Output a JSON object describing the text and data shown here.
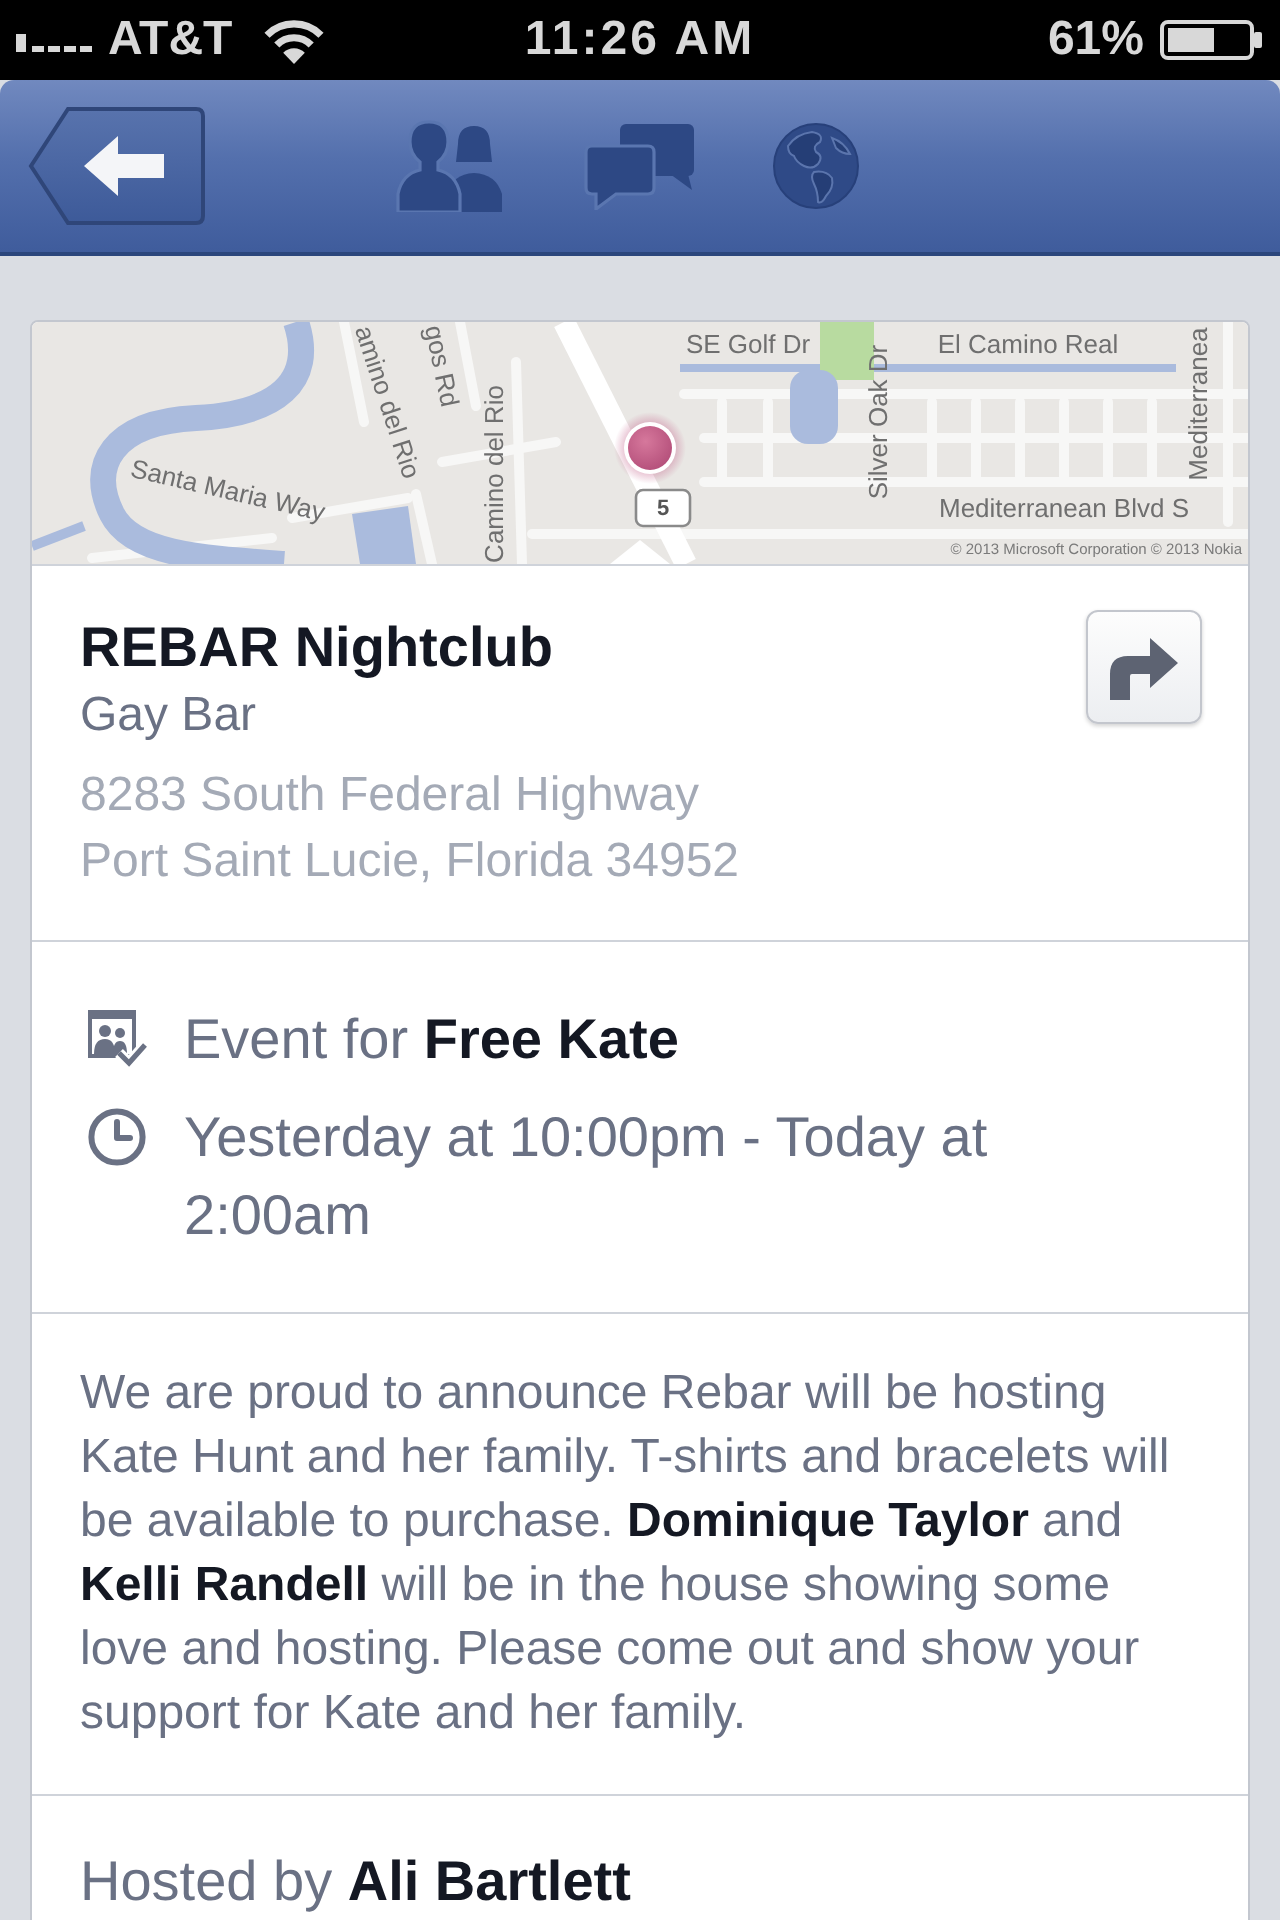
{
  "status_bar": {
    "carrier": "AT&T",
    "time": "11:26 AM",
    "battery": "61%"
  },
  "map": {
    "labels": [
      "SE Golf Dr",
      "El Camino Real",
      "amino del Rio",
      "gos Rd",
      "Camino del Rio",
      "Santa Maria Way",
      "Silver Oak Dr",
      "Mediterranea",
      "Mediterranean Blvd S"
    ],
    "route_shield": "5",
    "attribution": "© 2013 Microsoft Corporation © 2013 Nokia"
  },
  "place": {
    "name": "REBAR Nightclub",
    "category": "Gay Bar",
    "address_lines": [
      "8283 South Federal Highway",
      "Port Saint Lucie, Florida 34952"
    ]
  },
  "event_details": [
    {
      "kind": "host",
      "text": "Event for **Free Kate**"
    },
    {
      "kind": "time",
      "text": "Yesterday at 10:00pm - Today at 2:00am"
    }
  ],
  "description": "We are proud to announce Rebar will be hosting Kate Hunt and her family. T-shirts and bracelets will be available to purchase. **Dominique Taylor** and **Kelli Randell** will be in the house showing some love and hosting. Please come out and show your support for Kate and her family.",
  "hosted_by": "Hosted by **Ali Bartlett**"
}
